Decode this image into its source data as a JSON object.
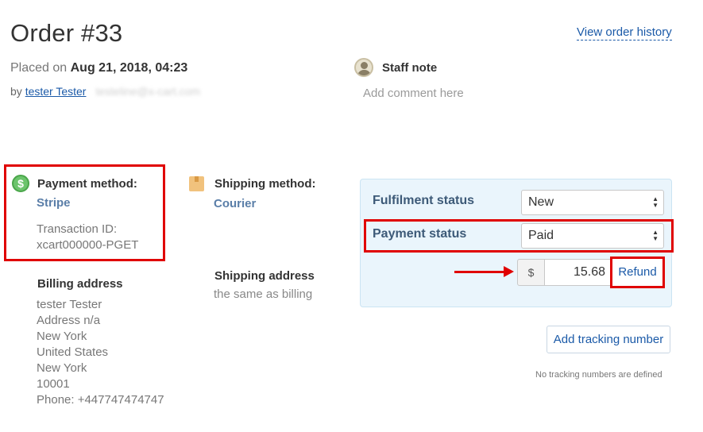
{
  "order": {
    "title": "Order #33",
    "history_link": "View order history",
    "placed_prefix": "Placed on",
    "placed_date": "Aug 21, 2018, 04:23",
    "by_prefix": "by",
    "customer_name": "tester Tester",
    "customer_email": "testeline@x-cart.com"
  },
  "staff_note": {
    "title": "Staff note",
    "placeholder": "Add comment here"
  },
  "payment": {
    "label": "Payment method:",
    "method": "Stripe",
    "transaction_label": "Transaction ID:",
    "transaction_id": "xcart000000-PGET",
    "icon": "dollar-icon"
  },
  "shipping": {
    "label": "Shipping method:",
    "method": "Courier",
    "icon": "box-icon"
  },
  "billing_address": {
    "title": "Billing address",
    "lines": [
      "tester Tester",
      "Address n/a",
      "New York",
      "United States",
      "New York",
      "10001",
      "Phone: +447747474747"
    ]
  },
  "shipping_address": {
    "title": "Shipping address",
    "value": "the same as billing"
  },
  "status": {
    "fulfilment_label": "Fulfilment status",
    "fulfilment_value": "New",
    "payment_label": "Payment status",
    "payment_value": "Paid",
    "currency_symbol": "$",
    "amount": "15.68",
    "refund_label": "Refund"
  },
  "tracking": {
    "add_button": "Add tracking number",
    "empty_text": "No tracking numbers are defined"
  },
  "colors": {
    "highlight": "#e00000",
    "link": "#1b5aa8",
    "panel_bg": "#eaf5fc"
  }
}
